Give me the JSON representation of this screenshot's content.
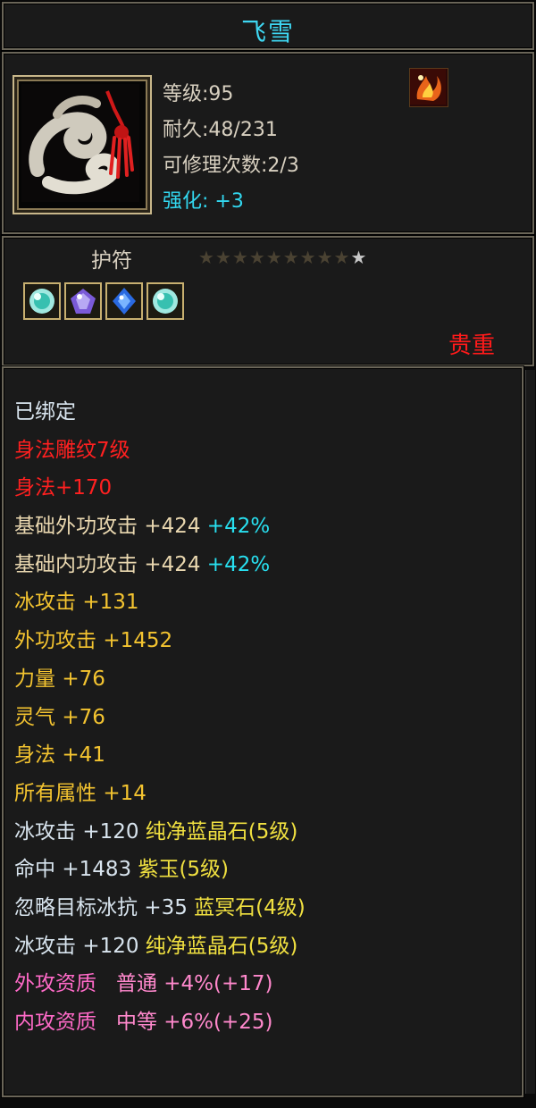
{
  "item": {
    "name": "飞雪",
    "icon": "jade-pendant-icon",
    "level": "等级:95",
    "durability": "耐久:48/231",
    "repairs": "可修理次数:2/3",
    "enhance_label": "强化: ",
    "enhance_value": "+3",
    "skill_icon": "fire-skill-icon"
  },
  "sockets": {
    "type_label": "护符",
    "stars_total": 10,
    "stars_lit": 1,
    "gems": [
      {
        "icon": "green-gem-icon",
        "color": "#37c0b0"
      },
      {
        "icon": "purple-gem-icon",
        "color": "#7a5ad8"
      },
      {
        "icon": "blue-gem-icon",
        "color": "#2a6ae0"
      },
      {
        "icon": "green-gem-icon",
        "color": "#37c0b0"
      }
    ],
    "rarity": "贵重"
  },
  "stats": {
    "bound": "已绑定",
    "engraving": "身法雕纹7级",
    "agility_bonus": "身法+170",
    "lines": [
      {
        "name": "基础外功攻击",
        "value": "+424",
        "extra": "+42%"
      },
      {
        "name": "基础内功攻击",
        "value": "+424",
        "extra": "+42%"
      }
    ],
    "attrs": [
      {
        "name": "冰攻击",
        "value": "+131"
      },
      {
        "name": "外功攻击",
        "value": "+1452"
      },
      {
        "name": "力量",
        "value": "+76"
      },
      {
        "name": "灵气",
        "value": "+76"
      },
      {
        "name": "身法",
        "value": "+41"
      },
      {
        "name": "所有属性",
        "value": "+14"
      }
    ],
    "gem_attrs": [
      {
        "name": "冰攻击",
        "value": "+120",
        "gem": "纯净蓝晶石(5级)"
      },
      {
        "name": "命中",
        "value": "+1483",
        "gem": "紫玉(5级)"
      },
      {
        "name": "忽略目标冰抗",
        "value": "+35",
        "gem": "蓝冥石(4级)"
      },
      {
        "name": "冰攻击",
        "value": "+120",
        "gem": "纯净蓝晶石(5级)"
      }
    ],
    "qualities": [
      {
        "name": "外攻资质",
        "grade": "普通",
        "value": "+4%",
        "bonus": "(+17)"
      },
      {
        "name": "内攻资质",
        "grade": "中等",
        "value": "+6%",
        "bonus": "(+25)"
      }
    ]
  }
}
